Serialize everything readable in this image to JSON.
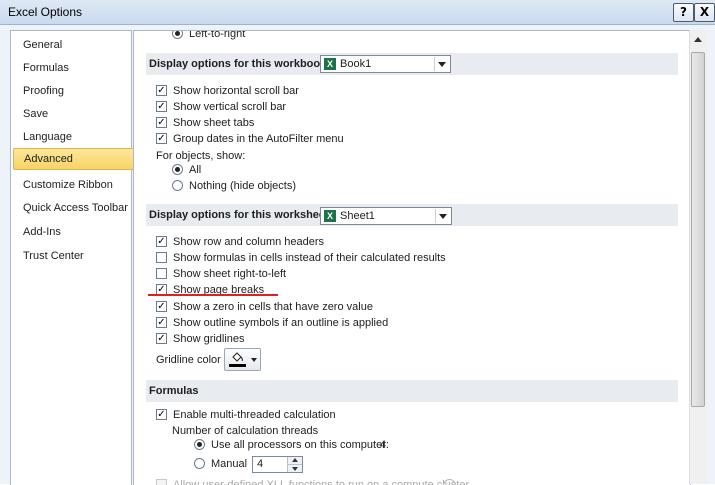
{
  "window": {
    "title": "Excel Options",
    "help_glyph": "?",
    "close_glyph": "X"
  },
  "colors": {
    "accent_selected": "#f8d467",
    "annotation_line": "#e02020"
  },
  "sidebar": {
    "items": [
      {
        "label": "General",
        "selected": false
      },
      {
        "label": "Formulas",
        "selected": false
      },
      {
        "label": "Proofing",
        "selected": false
      },
      {
        "label": "Save",
        "selected": false
      },
      {
        "label": "Language",
        "selected": false
      },
      {
        "label": "Advanced",
        "selected": true
      },
      {
        "label": "Customize Ribbon",
        "selected": false
      },
      {
        "label": "Quick Access Toolbar",
        "selected": false
      },
      {
        "label": "Add-Ins",
        "selected": false
      },
      {
        "label": "Trust Center",
        "selected": false
      }
    ]
  },
  "content": {
    "top_partial_option": {
      "label": "Left-to-right",
      "checked": true
    },
    "workbook_section": {
      "title": "Display options for this workbook:",
      "dropdown_value": "Book1",
      "options": [
        {
          "label": "Show horizontal scroll bar",
          "checked": true
        },
        {
          "label": "Show vertical scroll bar",
          "checked": true
        },
        {
          "label": "Show sheet tabs",
          "checked": true
        },
        {
          "label": "Group dates in the AutoFilter menu",
          "checked": true
        }
      ],
      "objects_label": "For objects, show:",
      "objects_options": [
        {
          "label": "All",
          "checked": true
        },
        {
          "label": "Nothing (hide objects)",
          "checked": false
        }
      ]
    },
    "worksheet_section": {
      "title": "Display options for this worksheet:",
      "dropdown_value": "Sheet1",
      "options": [
        {
          "label": "Show row and column headers",
          "checked": true
        },
        {
          "label": "Show formulas in cells instead of their calculated results",
          "checked": false
        },
        {
          "label": "Show sheet right-to-left",
          "checked": false
        },
        {
          "label": "Show page breaks",
          "checked": true
        },
        {
          "label": "Show a zero in cells that have zero value",
          "checked": true
        },
        {
          "label": "Show outline symbols if an outline is applied",
          "checked": true
        },
        {
          "label": "Show gridlines",
          "checked": true
        }
      ],
      "gridline_color_label": "Gridline color"
    },
    "formulas_section": {
      "title": "Formulas",
      "multithread": {
        "label": "Enable multi-threaded calculation",
        "checked": true
      },
      "threads_label": "Number of calculation threads",
      "use_all": {
        "label": "Use all processors on this computer:",
        "checked": true,
        "count": "4"
      },
      "manual": {
        "label": "Manual",
        "checked": false,
        "value": "4"
      },
      "xll_option": {
        "label": "Allow user-defined XLL functions to run on a compute cluster",
        "checked": false
      }
    }
  }
}
